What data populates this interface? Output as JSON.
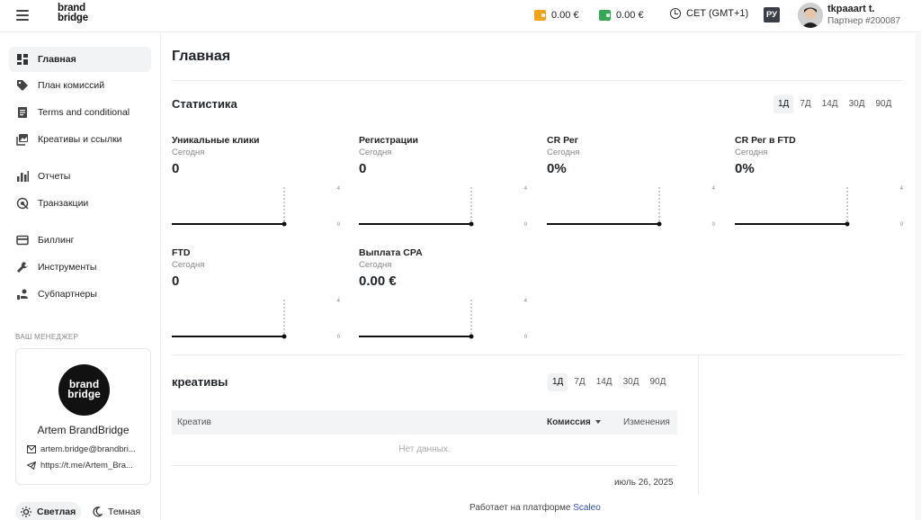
{
  "header": {
    "logo_line1": "brand",
    "logo_line2": "bridge",
    "wallet1_value": "0.00 €",
    "wallet1_color": "#f2a31a",
    "wallet2_value": "0.00 €",
    "wallet2_color": "#34a853",
    "timezone": "CET (GMT+1)",
    "language": "РУ",
    "username": "tkpaaart t.",
    "partner": "Партнер #200087"
  },
  "sidebar": {
    "items": [
      {
        "label": "Главная",
        "icon": "dashboard-icon"
      },
      {
        "label": "План комиссий",
        "icon": "tag-icon"
      },
      {
        "label": "Terms and conditional",
        "icon": "document-icon"
      },
      {
        "label": "Креативы и ссылки",
        "icon": "images-icon"
      },
      {
        "label": "Отчеты",
        "icon": "bar-chart-icon"
      },
      {
        "label": "Транзакции",
        "icon": "transactions-icon"
      },
      {
        "label": "Биллинг",
        "icon": "credit-card-icon"
      },
      {
        "label": "Инструменты",
        "icon": "wrench-icon"
      },
      {
        "label": "Субпартнеры",
        "icon": "subpartners-icon"
      }
    ],
    "manager_title": "ВАШ МЕНЕДЖЕР",
    "manager": {
      "logo_line1": "brand",
      "logo_line2": "bridge",
      "name": "Artem BrandBridge",
      "email": "artem.bridge@brandbri...",
      "telegram": "https://t.me/Artem_Bra..."
    },
    "theme_light": "Светлая",
    "theme_dark": "Темная"
  },
  "main": {
    "title": "Главная",
    "stats_title": "Статистика",
    "periods": [
      "1Д",
      "7Д",
      "14Д",
      "30Д",
      "90Д"
    ],
    "active_period": "1Д",
    "stats": [
      {
        "label": "Уникальные клики",
        "sub": "Сегодня",
        "value": "0",
        "axis_max": "4",
        "axis_min": "0"
      },
      {
        "label": "Регистрации",
        "sub": "Сегодня",
        "value": "0",
        "axis_max": "4",
        "axis_min": "0"
      },
      {
        "label": "CR Рег",
        "sub": "Сегодня",
        "value": "0%",
        "axis_max": "4",
        "axis_min": "0"
      },
      {
        "label": "CR Рег в FTD",
        "sub": "Сегодня",
        "value": "0%",
        "axis_max": "4",
        "axis_min": "0"
      },
      {
        "label": "FTD",
        "sub": "Сегодня",
        "value": "0",
        "axis_max": "4",
        "axis_min": "0"
      },
      {
        "label": "Выплата CPA",
        "sub": "Сегодня",
        "value": "0.00 €",
        "axis_max": "4",
        "axis_min": "0"
      }
    ],
    "creatives_title": "креативы",
    "creatives_periods": [
      "1Д",
      "7Д",
      "14Д",
      "30Д",
      "90Д"
    ],
    "table": {
      "col_creative": "Креатив",
      "col_commission": "Комиссия",
      "col_changes": "Изменения",
      "empty": "Нет данных."
    },
    "date": "июль 26, 2025"
  },
  "footer": {
    "text": "Работает на платформе",
    "link": "Scaleo"
  }
}
